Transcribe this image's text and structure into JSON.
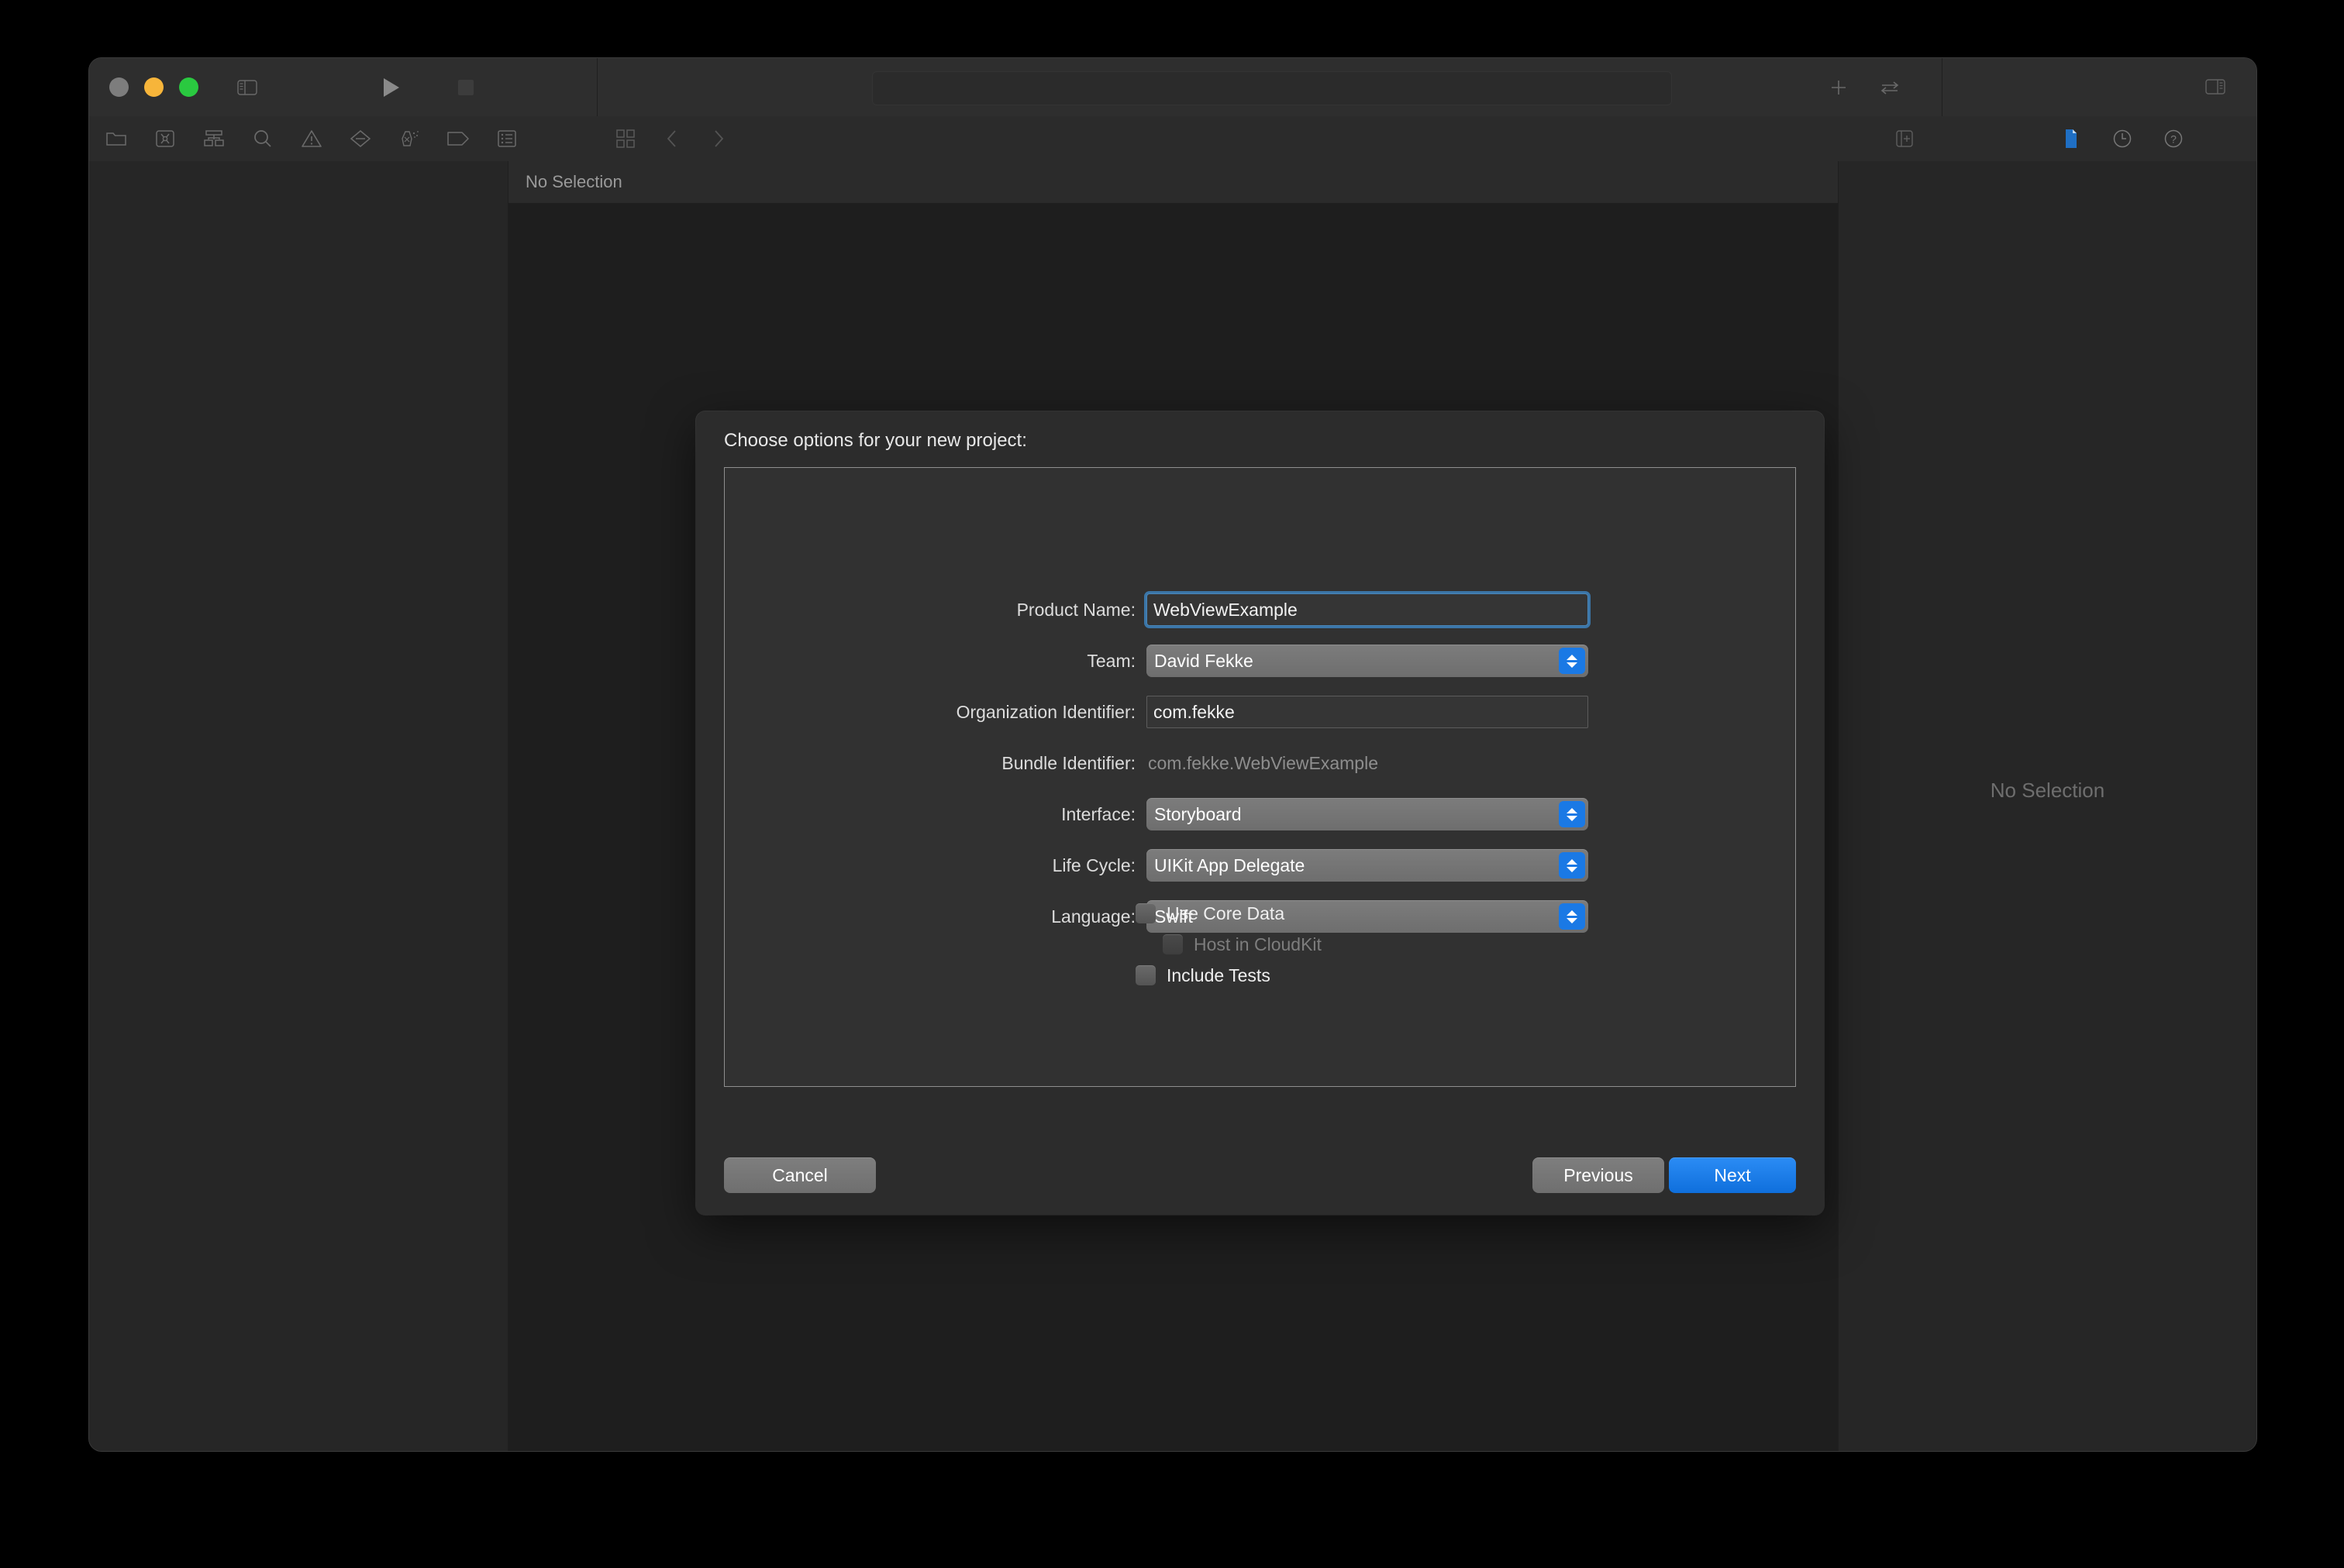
{
  "window": {
    "traffic_lights": [
      "close",
      "minimize",
      "zoom"
    ],
    "toolbar": {
      "sidebar_toggle_left": "left-sidebar-toggle-icon",
      "run_button": "play-icon",
      "stop_button": "stop-icon",
      "add_button": "plus-icon",
      "swap_button": "swap-arrows-icon",
      "sidebar_toggle_right": "right-sidebar-toggle-icon",
      "activity_status": ""
    },
    "navigator_tabs": [
      "project-navigator-icon",
      "source-control-navigator-icon",
      "hierarchy-navigator-icon",
      "find-navigator-icon",
      "issue-navigator-icon",
      "breakpoint-navigator-icon",
      "test-navigator-icon",
      "tag-navigator-icon",
      "report-navigator-icon"
    ],
    "jumpbar": {
      "grid_icon": "related-items-icon",
      "back_icon": "chevron-left-icon",
      "forward_icon": "chevron-right-icon",
      "selection_label": "No Selection",
      "editor_add_icon": "add-editor-icon"
    },
    "inspector_tabs": [
      "file-inspector-icon",
      "history-inspector-icon",
      "quick-help-inspector-icon"
    ],
    "inspector": {
      "empty_label": "No Selection"
    }
  },
  "dialog": {
    "title": "Choose options for your new project:",
    "fields": [
      {
        "label": "Product Name:",
        "type": "textfield",
        "value": "WebViewExample",
        "focused": true
      },
      {
        "label": "Team:",
        "type": "popup",
        "value": "David Fekke"
      },
      {
        "label": "Organization Identifier:",
        "type": "textfield",
        "value": "com.fekke",
        "focused": false
      },
      {
        "label": "Bundle Identifier:",
        "type": "static",
        "value": "com.fekke.WebViewExample"
      },
      {
        "label": "Interface:",
        "type": "popup",
        "value": "Storyboard"
      },
      {
        "label": "Life Cycle:",
        "type": "popup",
        "value": "UIKit App Delegate"
      },
      {
        "label": "Language:",
        "type": "popup",
        "value": "Swift"
      }
    ],
    "checkboxes": [
      {
        "label": "Use Core Data",
        "checked": false,
        "disabled": false,
        "indent": false
      },
      {
        "label": "Host in CloudKit",
        "checked": false,
        "disabled": true,
        "indent": true
      },
      {
        "label": "Include Tests",
        "checked": false,
        "disabled": false,
        "indent": false
      }
    ],
    "buttons": {
      "cancel": "Cancel",
      "previous": "Previous",
      "next": "Next"
    }
  },
  "colors": {
    "accent_blue": "#1a79e5",
    "default_button_blue": "#1f7df0",
    "focus_ring": "#3b76a8",
    "window_bg": "#292929",
    "sheet_bg": "#2c2c2c",
    "panel_bg": "#313131",
    "traffic_close": "#7d7d7d",
    "traffic_min": "#f7b53a",
    "traffic_max": "#2ac940"
  }
}
